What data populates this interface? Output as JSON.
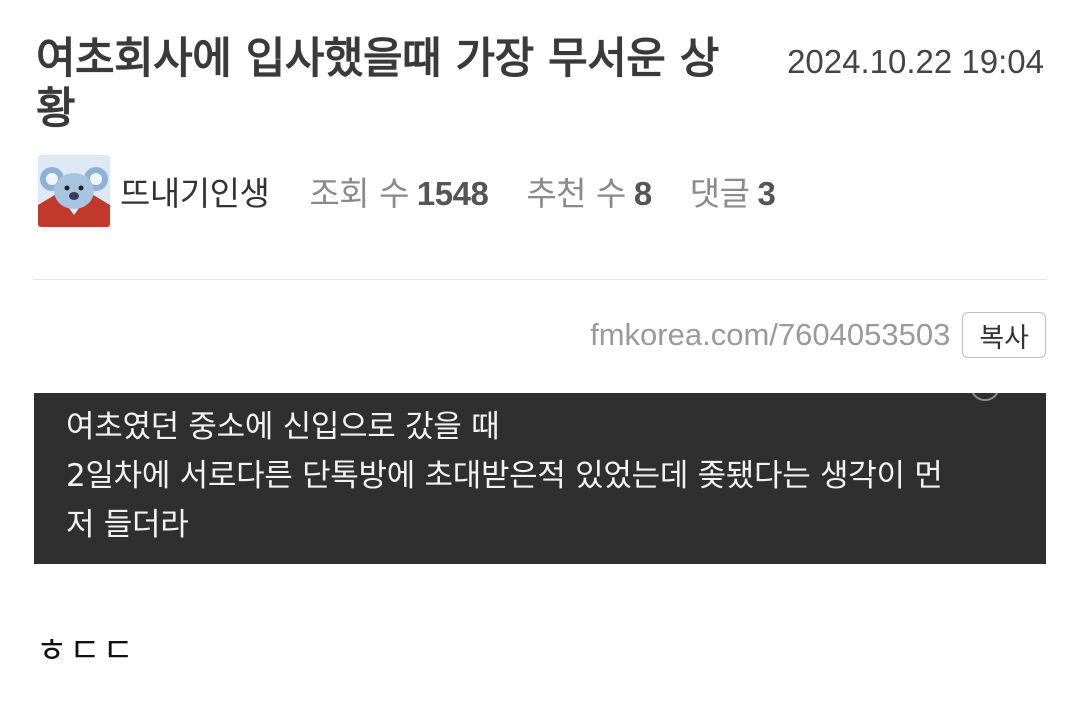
{
  "post": {
    "title": "여초회사에 입사했을때 가장 무서운 상황",
    "date": "2024.10.22 19:04"
  },
  "meta": {
    "author": "뜨내기인생",
    "views_label": "조회 수",
    "views": "1548",
    "recommends_label": "추천 수",
    "recommends": "8",
    "comments_label": "댓글",
    "comments": "3"
  },
  "share": {
    "url": "fmkorea.com/7604053503",
    "copy_label": "복사"
  },
  "quote": {
    "lines": [
      "여초였던 중소에 신입으로 갔을 때",
      "2일차에 서로다른 단톡방에 초대받은적 있었는데 좆됐다는 생각이 먼",
      "저 들더라"
    ]
  },
  "body": {
    "text": "ㅎㄷㄷ"
  },
  "icons": {
    "avatar": "koala-avatar-icon"
  }
}
